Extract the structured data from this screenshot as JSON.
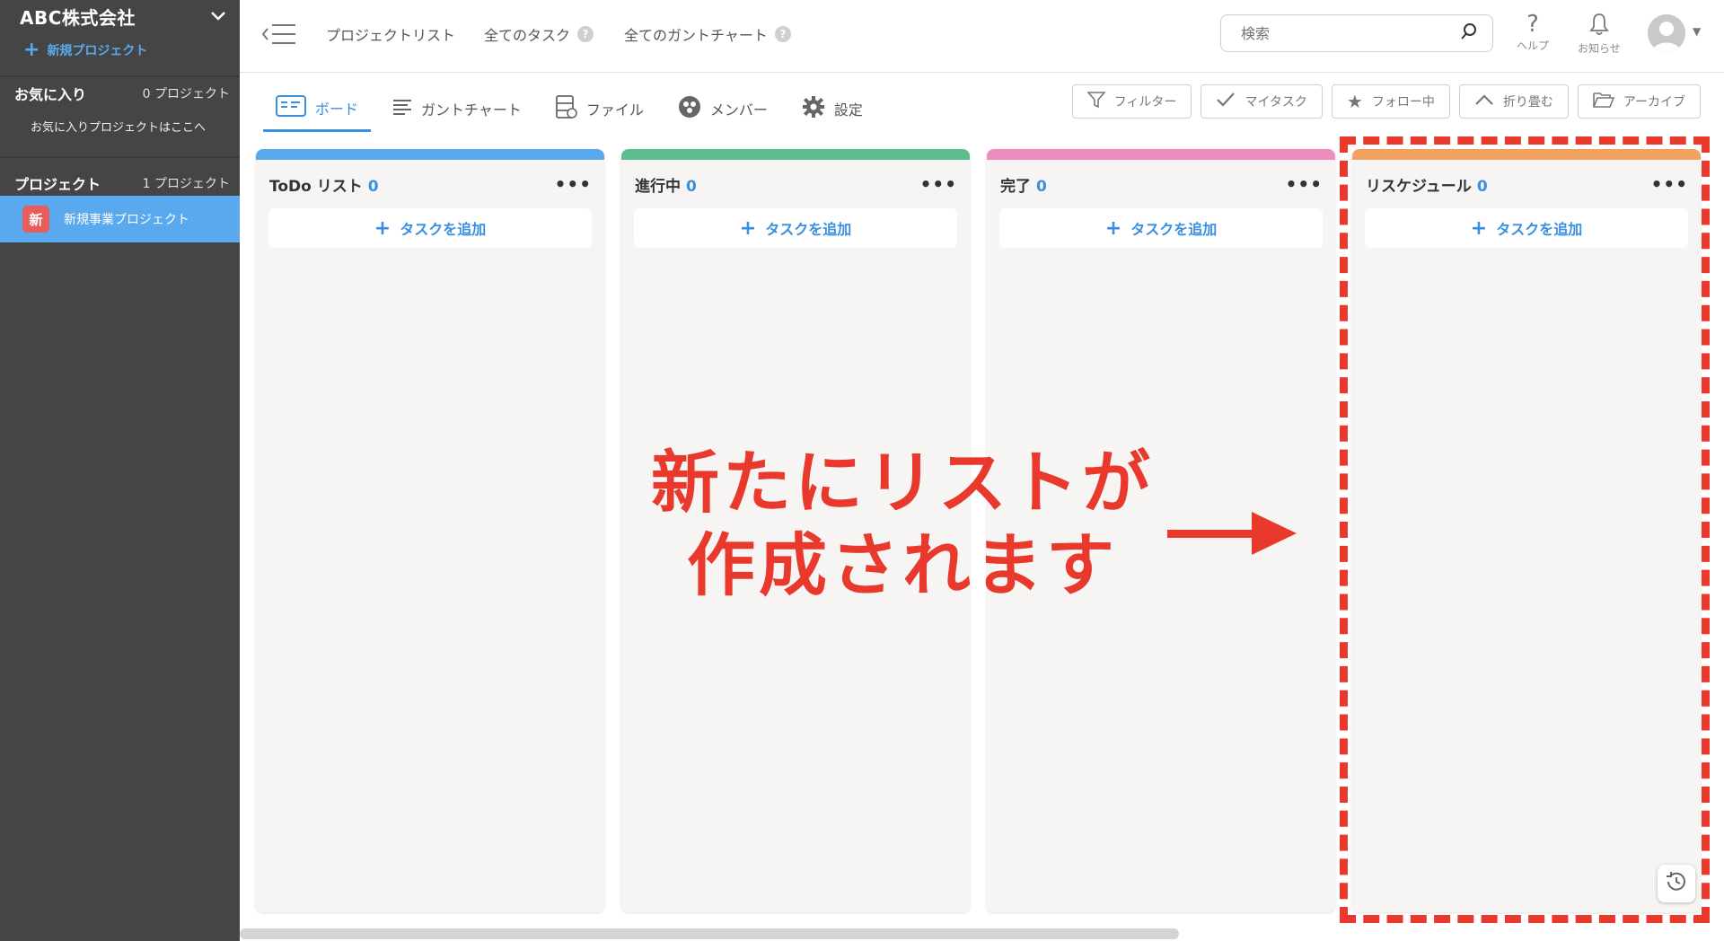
{
  "sidebar": {
    "company": "ABC株式会社",
    "new_project": "新規プロジェクト",
    "favorites": {
      "title": "お気に入り",
      "count": "0 プロジェクト",
      "placeholder": "お気に入りプロジェクトはここへ"
    },
    "projects": {
      "title": "プロジェクト",
      "count": "1 プロジェクト"
    },
    "project_items": [
      {
        "badge": "新",
        "name": "新規事業プロジェクト"
      }
    ]
  },
  "topbar": {
    "nav": [
      "プロジェクトリスト",
      "全てのタスク",
      "全てのガントチャート"
    ],
    "search_placeholder": "検索",
    "help": "ヘルプ",
    "notifications": "お知らせ"
  },
  "tabs": [
    "ボード",
    "ガントチャート",
    "ファイル",
    "メンバー",
    "設定"
  ],
  "toolbar": [
    "フィルター",
    "マイタスク",
    "フォロー中",
    "折り畳む",
    "アーカイブ"
  ],
  "columns": [
    {
      "title": "ToDo リスト",
      "count": "0",
      "color": "#5aa9ef",
      "add": "タスクを追加"
    },
    {
      "title": "進行中",
      "count": "0",
      "color": "#5dbd8c",
      "add": "タスクを追加"
    },
    {
      "title": "完了",
      "count": "0",
      "color": "#ec8cbf",
      "add": "タスクを追加"
    },
    {
      "title": "リスケジュール",
      "count": "0",
      "color": "#f3a15e",
      "add": "タスクを追加"
    }
  ],
  "annotation": {
    "line1": "新たにリストが",
    "line2": "作成されます",
    "color": "#e8392c"
  }
}
